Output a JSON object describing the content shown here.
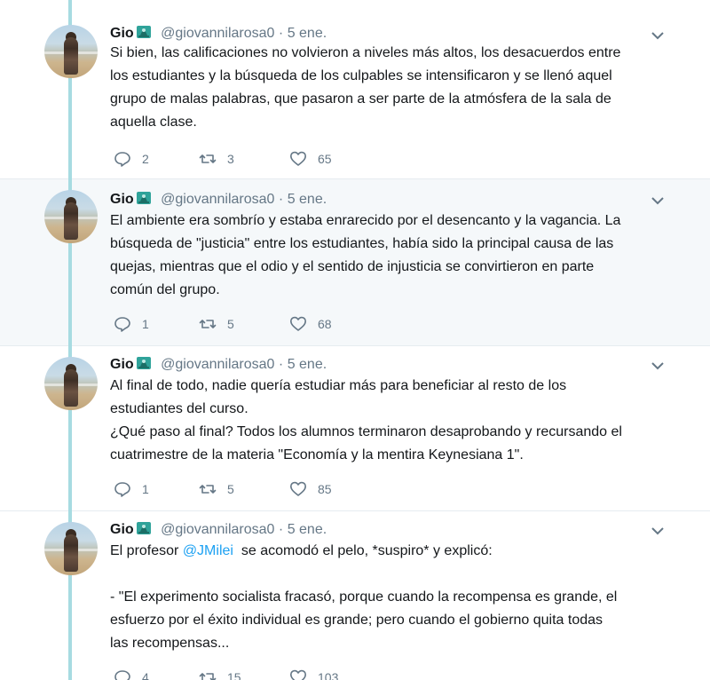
{
  "tweets": [
    {
      "name": "Gio",
      "handle": "@giovannilarosa0",
      "separator": "·",
      "date": "5 ene.",
      "lines": [
        "Si bien, las calificaciones no volvieron a niveles más altos, los desacuerdos entre",
        "los estudiantes y la búsqueda de los culpables se intensificaron y se llenó aquel",
        "grupo de malas palabras, que pasaron a ser parte de la atmósfera de la sala de",
        "aquella clase."
      ],
      "replies": "2",
      "retweets": "3",
      "likes": "65"
    },
    {
      "name": "Gio",
      "handle": "@giovannilarosa0",
      "separator": "·",
      "date": "5 ene.",
      "lines": [
        "El ambiente era sombrío y estaba enrarecido por el desencanto y la vagancia. La",
        "búsqueda de \"justicia\" entre los estudiantes, había sido la principal causa de las",
        "quejas, mientras que el odio y el sentido de injusticia se convirtieron en parte",
        "común del grupo."
      ],
      "replies": "1",
      "retweets": "5",
      "likes": "68"
    },
    {
      "name": "Gio",
      "handle": "@giovannilarosa0",
      "separator": "·",
      "date": "5 ene.",
      "lines": [
        "Al final de todo, nadie quería estudiar más para beneficiar al resto de los",
        "estudiantes del curso.",
        "¿Qué paso al final? Todos los alumnos terminaron desaprobando y recursando el",
        "cuatrimestre de la materia \"Economía y la mentira Keynesiana 1\"."
      ],
      "replies": "1",
      "retweets": "5",
      "likes": "85"
    },
    {
      "name": "Gio",
      "handle": "@giovannilarosa0",
      "separator": "·",
      "date": "5 ene.",
      "line1_prefix": "El profesor ",
      "mention": "@JMilei",
      "line1_suffix": "  se acomodó el pelo, *suspiro* y explicó:",
      "lines": [
        "- \"El experimento socialista fracasó, porque cuando la recompensa es grande, el",
        "esfuerzo por el éxito individual es grande; pero cuando el gobierno quita todas",
        "las recompensas..."
      ],
      "replies": "4",
      "retweets": "15",
      "likes": "103"
    }
  ],
  "icons": {
    "reply": "reply-icon",
    "retweet": "retweet-icon",
    "like": "heart-icon",
    "menu": "chevron-down-icon",
    "emoji": "statue-of-liberty-emoji"
  },
  "colors": {
    "thread_line": "#a7dbe1",
    "link": "#1da1f2",
    "muted": "#657786",
    "highlight_bg": "#f5f8fa"
  }
}
